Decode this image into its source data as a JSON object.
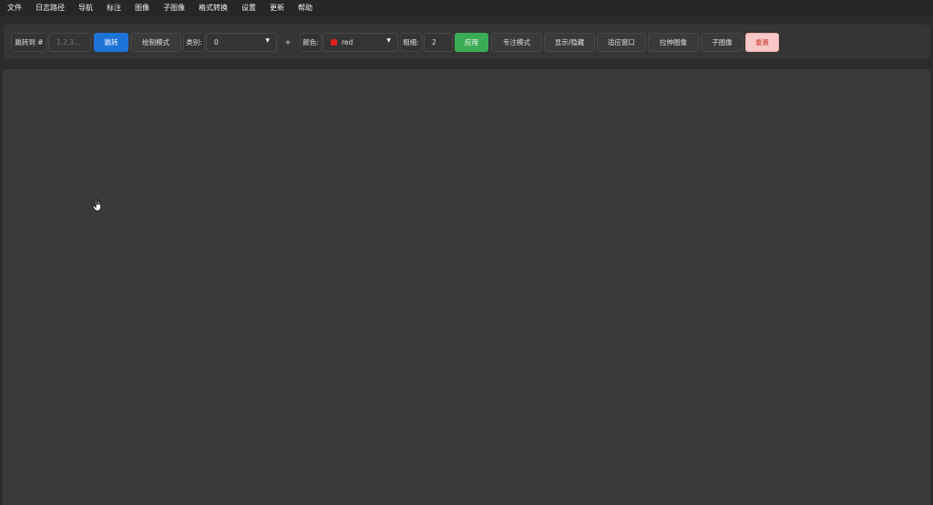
{
  "menu": {
    "items": [
      "文件",
      "日志路径",
      "导航",
      "标注",
      "图像",
      "子图像",
      "格式转换",
      "设置",
      "更新",
      "帮助"
    ]
  },
  "toolbar": {
    "jump_label": "跳转到 #",
    "jump_placeholder": "1,2,3...",
    "jump_button": "跳转",
    "draw_mode_button": "绘制模式",
    "category_label": "类别:",
    "category_value": "0",
    "add_symbol": "+",
    "color_label": "颜色:",
    "color_value": "red",
    "color_swatch": "#e02020",
    "thickness_label": "粗细:",
    "thickness_value": "2",
    "apply_button": "应用",
    "focus_mode_button": "专注模式",
    "toggle_button": "显示/隐藏",
    "fit_window_button": "适应窗口",
    "stretch_button": "拉伸图像",
    "subimage_button": "子图像",
    "reset_button": "重置"
  },
  "colors": {
    "accent_blue": "#1e74d6",
    "accent_green": "#3cab55",
    "reset_bg": "#f9c7c7"
  },
  "cursor": {
    "icon": "hand-pointer-icon"
  }
}
